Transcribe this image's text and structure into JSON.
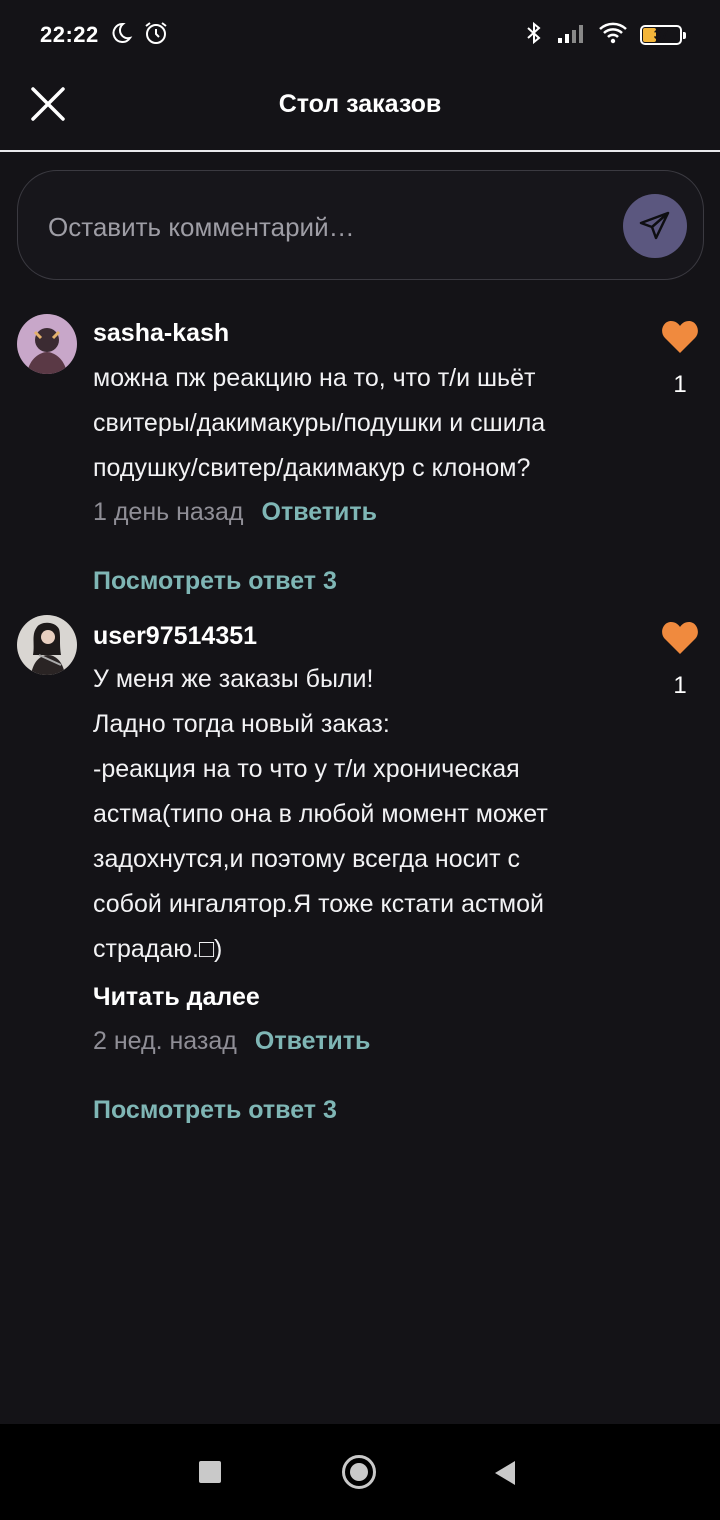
{
  "status_bar": {
    "time": "22:22",
    "battery_level": "37",
    "battery_fraction": 0.37,
    "icons": [
      "moon-icon",
      "alarm-icon",
      "bluetooth-icon",
      "signal-icon",
      "wifi-icon",
      "battery-icon"
    ]
  },
  "header": {
    "title": "Стол заказов",
    "close_icon": "close-icon"
  },
  "comment_box": {
    "placeholder": "Оставить комментарий…",
    "send_icon": "send-icon"
  },
  "comments": [
    {
      "author": "sasha-kash",
      "lines": [
        "можна пж реакцию на то, что т/и шьёт",
        "свитеры/дакимакуры/подушки и сшила",
        "подушку/свитер/дакимакур с клоном?"
      ],
      "time": "1 день назад",
      "reply_label": "Ответить",
      "view_replies": "Посмотреть ответ 3",
      "likes": "1"
    },
    {
      "author": "user97514351",
      "lines": [
        "У меня же заказы были!",
        "Ладно тогда новый заказ:",
        "-реакция на то что у т/и хроническая",
        "астма(типо она в любой момент может",
        "задохнутся,и поэтому всегда носит с",
        "собой ингалятор.Я тоже кстати астмой",
        "страдаю.□)"
      ],
      "read_more": "Читать далее",
      "time": "2 нед. назад",
      "reply_label": "Ответить",
      "view_replies": "Посмотреть ответ 3",
      "likes": "1"
    }
  ],
  "colors": {
    "background": "#141317",
    "accent_teal": "#7fb6b5",
    "heart": "#f08a3e",
    "send_button": "#5b577f"
  },
  "nav_bar": {
    "icons": [
      "recent-apps-icon",
      "home-icon",
      "back-icon"
    ]
  }
}
